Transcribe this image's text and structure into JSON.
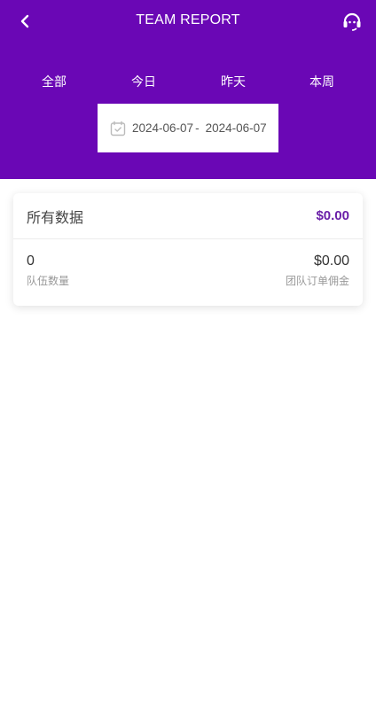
{
  "header": {
    "title": "TEAM REPORT",
    "back_icon": "chevron-left-icon",
    "support_icon": "headset-icon",
    "background": "#6a07b5"
  },
  "tabs": [
    {
      "label": "全部"
    },
    {
      "label": "今日"
    },
    {
      "label": "昨天"
    },
    {
      "label": "本周"
    }
  ],
  "date_range": {
    "icon": "calendar-check-icon",
    "start": "2024-06-07",
    "separator": "-",
    "end": "2024-06-07"
  },
  "summary": {
    "title": "所有数据",
    "total": "$0.00",
    "team_count": {
      "value": "0",
      "label": "队伍数量"
    },
    "commission": {
      "value": "$0.00",
      "label": "团队订单佣金"
    }
  }
}
